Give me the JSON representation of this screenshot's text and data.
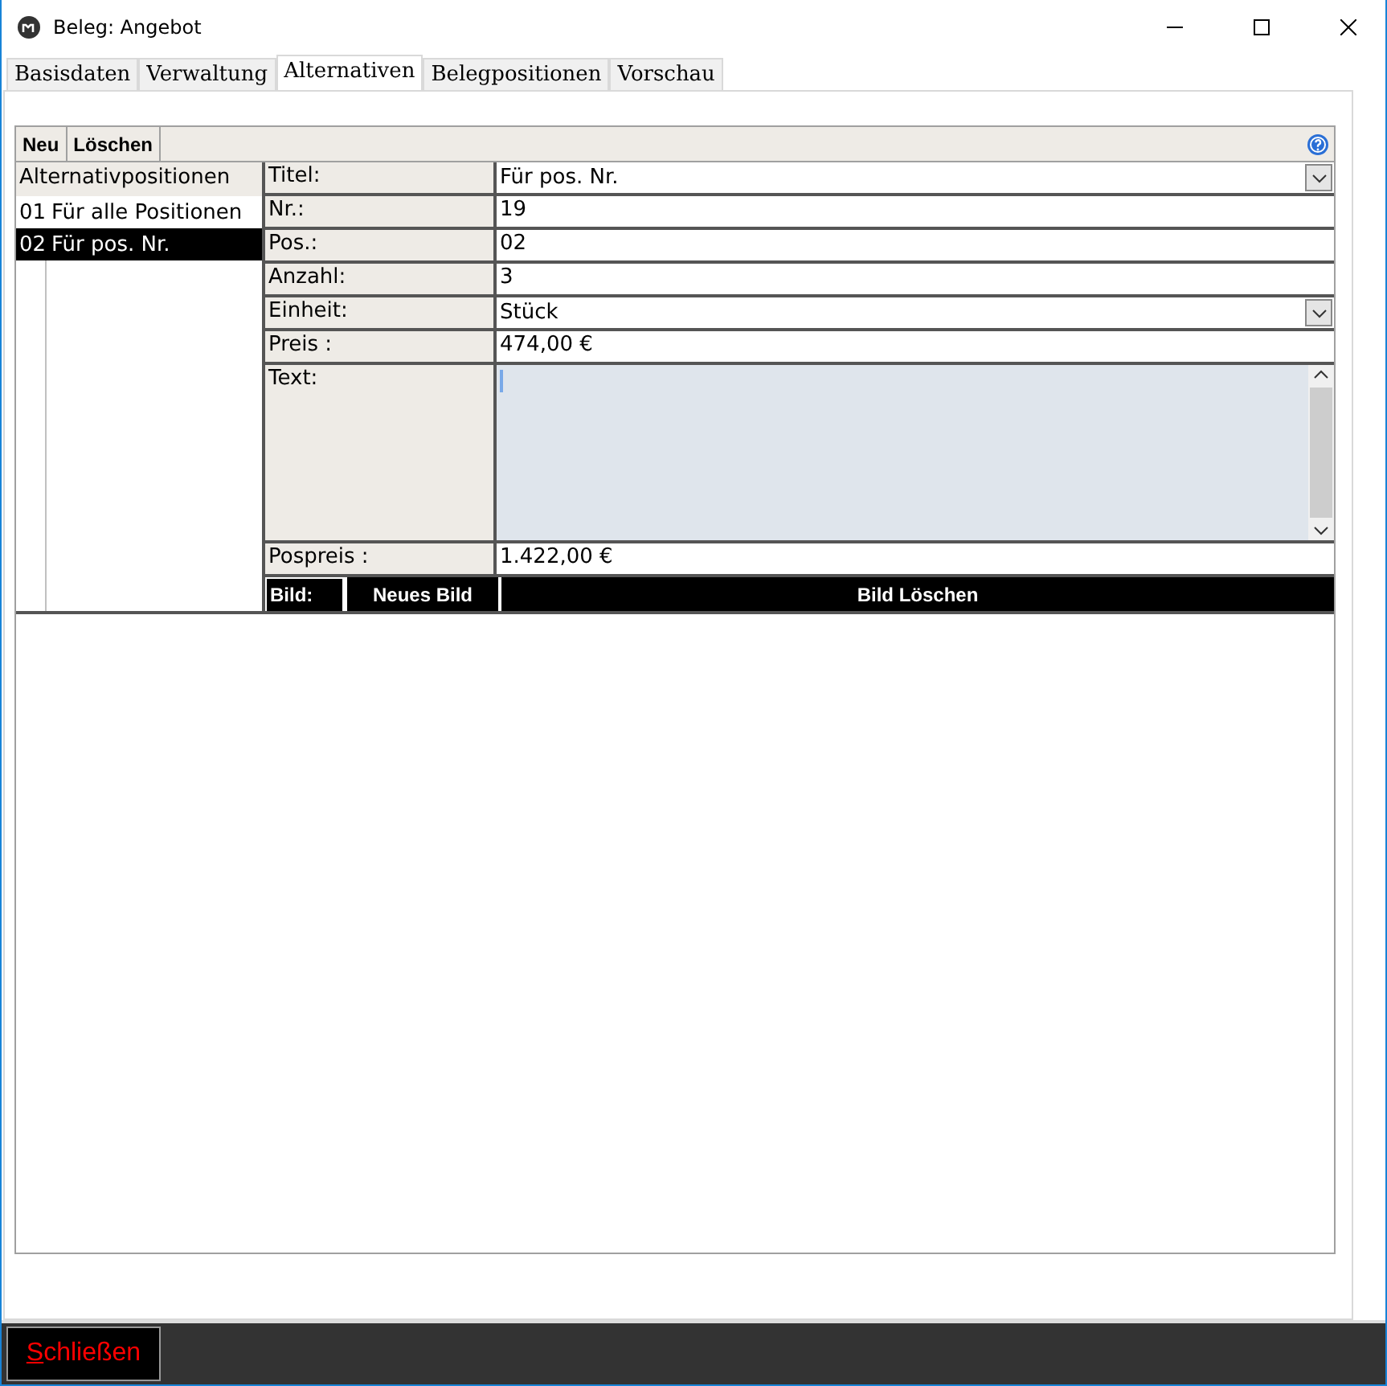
{
  "window": {
    "title": "Beleg: Angebot"
  },
  "tabs": [
    {
      "label": "Basisdaten",
      "selected": false
    },
    {
      "label": "Verwaltung",
      "selected": false
    },
    {
      "label": "Alternativen",
      "selected": true
    },
    {
      "label": "Belegpositionen",
      "selected": false
    },
    {
      "label": "Vorschau",
      "selected": false
    }
  ],
  "toolbar": [
    "Neu",
    "Löschen"
  ],
  "list": {
    "header": "Alternativpositionen",
    "items": [
      {
        "nr": "01",
        "label": "Für alle Positionen",
        "selected": false
      },
      {
        "nr": "02",
        "label": "Für pos. Nr.",
        "selected": true
      }
    ]
  },
  "fields": [
    {
      "label": "Titel:",
      "kind": "dropdown",
      "value": "Für pos. Nr."
    },
    {
      "label": "Nr.:",
      "kind": "text",
      "value": "19"
    },
    {
      "label": "Pos.:",
      "kind": "text",
      "value": "02"
    },
    {
      "label": "Anzahl:",
      "kind": "text",
      "value": "3"
    },
    {
      "label": "Einheit:",
      "kind": "dropdown",
      "value": "Stück"
    },
    {
      "label": "Preis :",
      "kind": "text",
      "value": "474,00 €"
    },
    {
      "label": "Text:",
      "kind": "textarea"
    },
    {
      "label": "Pospreis :",
      "kind": "text",
      "value": "1.422,00 €"
    }
  ],
  "image_row": {
    "label": "Bild:",
    "buttons": [
      "Neues Bild",
      "Bild Löschen"
    ]
  },
  "footer": {
    "close": {
      "label": "Schließen",
      "mnemonic": true
    }
  }
}
